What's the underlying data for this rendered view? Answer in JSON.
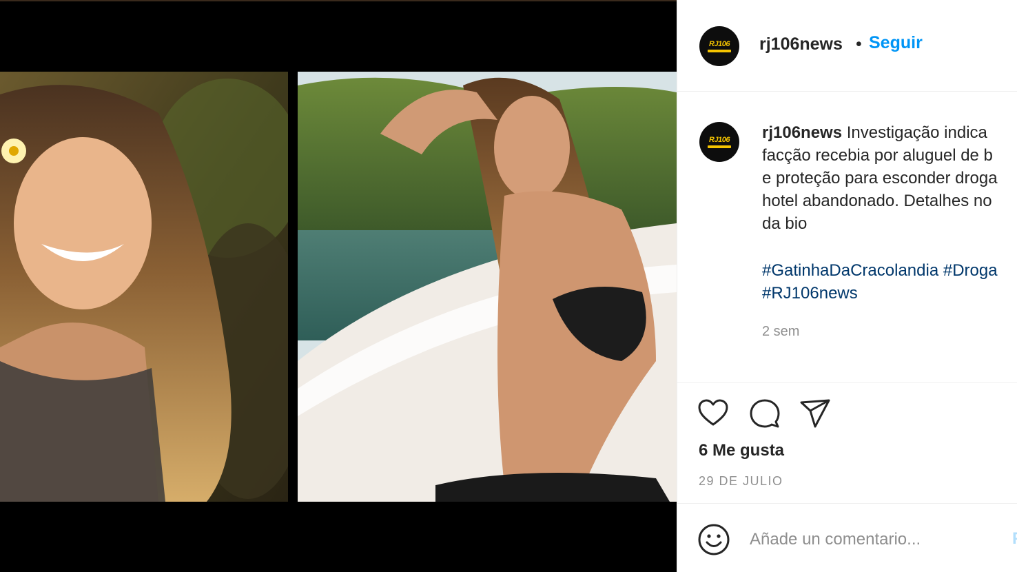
{
  "post": {
    "username": "rj106news",
    "follow_label": "Seguir",
    "separator": "•",
    "avatar_logo_text": "RJ106",
    "caption_lines": [
      "Investigação indica",
      "facção recebia por aluguel de b",
      "e proteção para esconder droga",
      "hotel abandonado. Detalhes no",
      "da bio"
    ],
    "hashtags": [
      "#GatinhaDaCracolandia",
      "#Droga",
      "#RJ106news"
    ],
    "time_ago": "2 sem",
    "likes": "6 Me gusta",
    "date": "29 DE JULIO",
    "comment_placeholder": "Añade un comentario...",
    "publish_label": "P"
  },
  "icons": {
    "like": "heart-icon",
    "comment": "comment-bubble-icon",
    "share": "paper-plane-icon",
    "emoji": "smiley-icon"
  },
  "colors": {
    "link_blue": "#0095f6",
    "hashtag": "#00376b",
    "text": "#262626",
    "muted": "#8e8e8e",
    "logo_yellow": "#f5c400"
  }
}
